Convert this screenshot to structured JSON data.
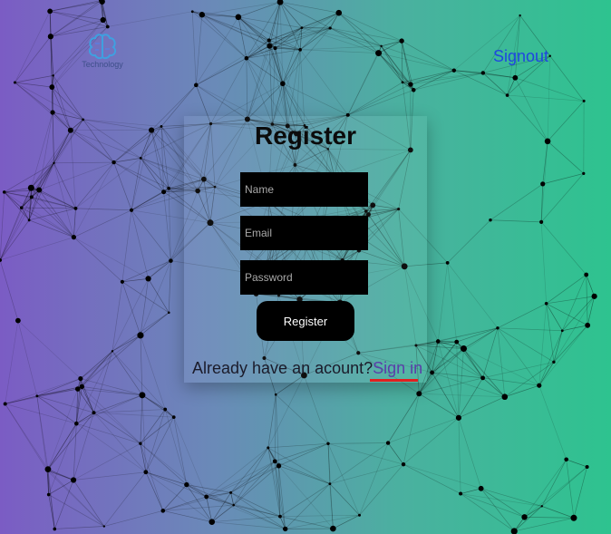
{
  "header": {
    "logo_text": "Technology",
    "signout_label": "Signout"
  },
  "form": {
    "title": "Register",
    "name_placeholder": "Name",
    "email_placeholder": "Email",
    "password_placeholder": "Password",
    "submit_label": "Register",
    "account_prompt": "Already have an acount?",
    "signin_link": "Sign in"
  },
  "colors": {
    "gradient_left": "#7b5cc4",
    "gradient_right": "#2ec38f",
    "link_blue": "#1f46e0",
    "signin_purple": "#5a3ea8",
    "underline_red": "#e02020"
  }
}
